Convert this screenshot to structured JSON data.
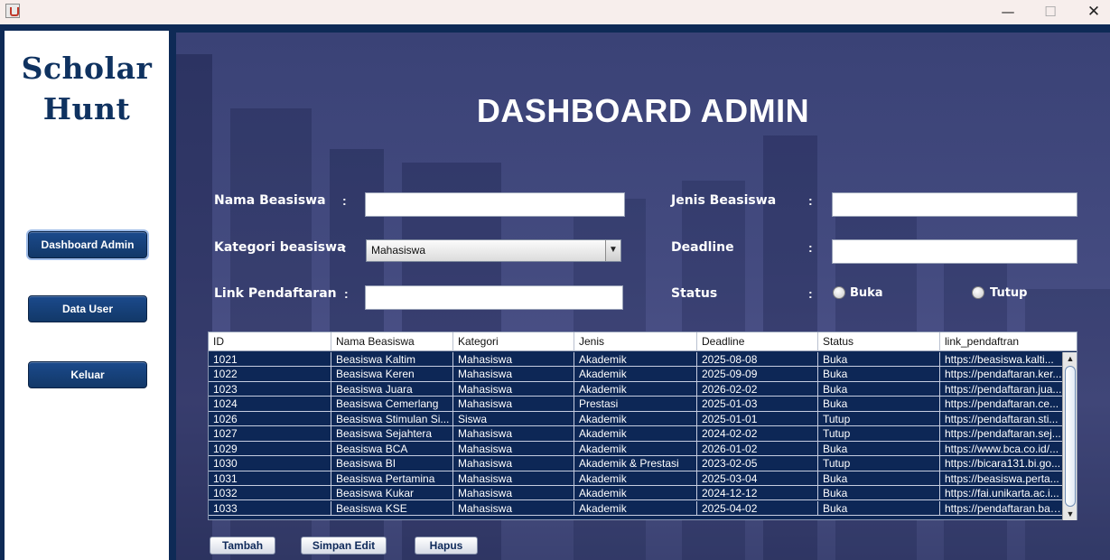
{
  "window": {
    "minimize_glyph": "—",
    "maximize_glyph": "☐",
    "close_glyph": "✕"
  },
  "sidebar": {
    "logo_line1": "Scholar",
    "logo_line2": "Hunt",
    "items": [
      {
        "label": "Dashboard Admin",
        "active": true
      },
      {
        "label": "Data User",
        "active": false
      },
      {
        "label": "Keluar",
        "active": false
      }
    ]
  },
  "main": {
    "title": "DASHBOARD ADMIN",
    "form": {
      "colon": ":",
      "nama_label": "Nama Beasiswa",
      "nama_value": "",
      "jenis_label": "Jenis Beasiswa",
      "jenis_value": "",
      "kategori_label": "Kategori beasiswa",
      "kategori_selected": "Mahasiswa",
      "deadline_label": "Deadline",
      "deadline_value": "",
      "link_label": "Link Pendaftaran",
      "link_value": "",
      "status_label": "Status",
      "status_options": [
        "Buka",
        "Tutup"
      ]
    },
    "table": {
      "columns": [
        "ID",
        "Nama Beasiswa",
        "Kategori",
        "Jenis",
        "Deadline",
        "Status",
        "link_pendaftran"
      ],
      "rows": [
        [
          "1021",
          "Beasiswa Kaltim",
          "Mahasiswa",
          "Akademik",
          "2025-08-08",
          "Buka",
          "https://beasiswa.kalti..."
        ],
        [
          "1022",
          "Beasiswa Keren",
          "Mahasiswa",
          "Akademik",
          "2025-09-09",
          "Buka",
          "https://pendaftaran.ker..."
        ],
        [
          "1023",
          "Beasiswa Juara",
          "Mahasiswa",
          "Akademik",
          "2026-02-02",
          "Buka",
          "https://pendaftaran.jua..."
        ],
        [
          "1024",
          "Beasiswa Cemerlang",
          "Mahasiswa",
          "Prestasi",
          "2025-01-03",
          "Buka",
          "https://pendaftaran.ce..."
        ],
        [
          "1026",
          "Beasiswa Stimulan Si...",
          "Siswa",
          "Akademik",
          "2025-01-01",
          "Tutup",
          "https://pendaftaran.sti..."
        ],
        [
          "1027",
          "Beasiswa Sejahtera",
          "Mahasiswa",
          "Akademik",
          "2024-02-02",
          "Tutup",
          "https://pendaftaran.sej..."
        ],
        [
          "1029",
          "Beasiswa BCA",
          "Mahasiswa",
          "Akademik",
          "2026-01-02",
          "Buka",
          "https://www.bca.co.id/..."
        ],
        [
          "1030",
          "Beasiswa BI",
          "Mahasiswa",
          "Akademik & Prestasi",
          "2023-02-05",
          "Tutup",
          "https://bicara131.bi.go..."
        ],
        [
          "1031",
          "Beasiswa Pertamina",
          "Mahasiswa",
          "Akademik",
          "2025-03-04",
          "Buka",
          "https://beasiswa.perta..."
        ],
        [
          "1032",
          "Beasiswa Kukar",
          "Mahasiswa",
          "Akademik",
          "2024-12-12",
          "Buka",
          "https://fai.unikarta.ac.i..."
        ],
        [
          "1033",
          "Beasiswa KSE",
          "Mahasiswa",
          "Akademik",
          "2025-04-02",
          "Buka",
          "https://pendaftaran.bali..."
        ]
      ]
    },
    "actions": {
      "tambah": "Tambah",
      "simpan": "Simpan Edit",
      "hapus": "Hapus"
    }
  },
  "colors": {
    "frame": "#0e2a56",
    "logo": "#0f3260",
    "table_bg": "#0d2756",
    "panel": "#444b80"
  },
  "icons": [
    "app-icon",
    "minimize-icon",
    "maximize-icon",
    "close-icon",
    "dropdown-arrow-icon",
    "scroll-up-icon",
    "scroll-down-icon"
  ]
}
